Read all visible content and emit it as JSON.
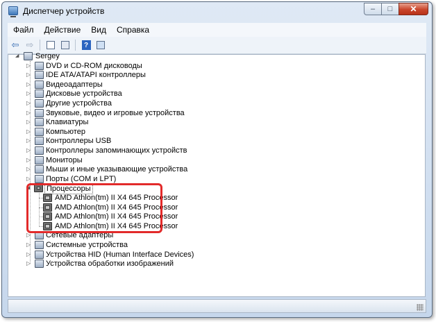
{
  "window": {
    "title": "Диспетчер устройств",
    "controls": {
      "minimize": "–",
      "maximize": "□",
      "close": "✕"
    }
  },
  "menu": [
    "Файл",
    "Действие",
    "Вид",
    "Справка"
  ],
  "toolbar": [
    "back-icon",
    "forward-icon",
    "properties-icon",
    "update-driver-icon",
    "help-icon",
    "scan-hardware-icon"
  ],
  "tree": {
    "root": "Sergey",
    "categories": [
      "DVD и CD-ROM дисководы",
      "IDE ATA/ATAPI контроллеры",
      "Видеоадаптеры",
      "Дисковые устройства",
      "Другие устройства",
      "Звуковые, видео и игровые устройства",
      "Клавиатуры",
      "Компьютер",
      "Контроллеры USB",
      "Контроллеры запоминающих устройств",
      "Мониторы",
      "Мыши и иные указывающие устройства",
      "Порты (COM и LPT)"
    ],
    "expanded": {
      "label": "Процессоры",
      "children": [
        "AMD Athlon(tm) II X4 645 Processor",
        "AMD Athlon(tm) II X4 645 Processor",
        "AMD Athlon(tm) II X4 645 Processor",
        "AMD Athlon(tm) II X4 645 Processor"
      ]
    },
    "categories_after": [
      "Сетевые адаптеры",
      "Системные устройства",
      "Устройства HID (Human Interface Devices)",
      "Устройства обработки изображений"
    ]
  },
  "colors": {
    "highlight": "#e22a2a",
    "window_frame": "#c6d7ec",
    "close_button": "#c9452b"
  }
}
